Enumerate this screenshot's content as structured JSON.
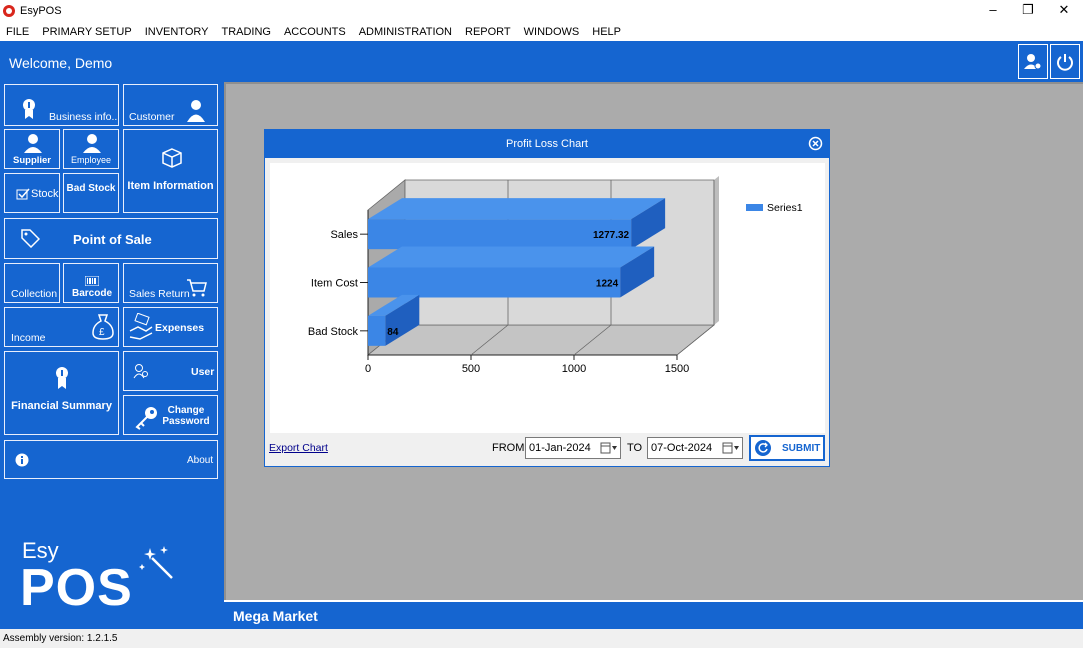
{
  "window": {
    "title": "EsyPOS"
  },
  "menu": [
    "FILE",
    "PRIMARY SETUP",
    "INVENTORY",
    "TRADING",
    "ACCOUNTS",
    "ADMINISTRATION",
    "REPORT",
    "WINDOWS",
    "HELP"
  ],
  "header": {
    "welcome": "Welcome, Demo"
  },
  "tiles": {
    "business_info": "Business info...",
    "customer": "Customer",
    "supplier": "Supplier",
    "employee": "Employee",
    "item_information": "Item Information",
    "stock": "Stock",
    "bad_stock": "Bad Stock",
    "point_of_sale": "Point of Sale",
    "collection": "Collection",
    "barcode": "Barcode",
    "sales_return": "Sales Return",
    "income": "Income",
    "expenses": "Expenses",
    "financial_summary": "Financial Summary",
    "user": "User",
    "change_password": "Change Password",
    "about": "About"
  },
  "logo": {
    "esy": "Esy",
    "pos": "POS"
  },
  "footer": {
    "market": "Mega Market",
    "assembly": "Assembly version: 1.2.1.5"
  },
  "dialog": {
    "title": "Profit Loss Chart",
    "export_label": "Export Chart",
    "from_label": "FROM",
    "from_value": "01-Jan-2024",
    "to_label": "TO",
    "to_value": "07-Oct-2024",
    "submit_label": "SUBMIT"
  },
  "chart_data": {
    "type": "bar",
    "orientation": "horizontal",
    "style": "3d",
    "categories": [
      "Sales",
      "Item Cost",
      "Bad Stock"
    ],
    "series": [
      {
        "name": "Series1",
        "values": [
          1277.32,
          1224,
          84
        ],
        "labels": [
          "1277.32",
          "1224",
          "84"
        ],
        "color": "#3b86e6"
      }
    ],
    "x_ticks": [
      "0",
      "500",
      "1000",
      "1500"
    ],
    "xlim": [
      0,
      1500
    ],
    "grid": true,
    "legend": "top-right"
  },
  "colors": {
    "primary": "#1565d0",
    "bar": "#3b86e6",
    "panel": "#ababab"
  }
}
